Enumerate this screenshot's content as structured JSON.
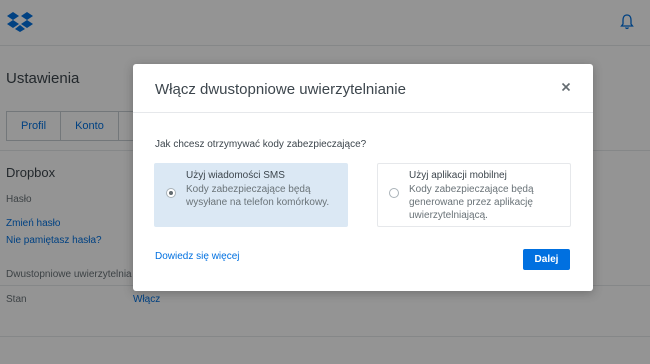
{
  "page": {
    "title": "Ustawienia",
    "tabs": [
      {
        "label": "Profil"
      },
      {
        "label": "Konto"
      },
      {
        "label": ""
      }
    ],
    "section_title": "Dropbox",
    "password_label": "Hasło",
    "change_password_link": "Zmień hasło",
    "forgot_password_link": "Nie pamiętasz hasła?",
    "two_step_label": "Dwustopniowe uwierzytelnia",
    "status_label": "Stan",
    "enable_link": "Włącz"
  },
  "modal": {
    "title": "Włącz dwustopniowe uwierzytelnianie",
    "question": "Jak chcesz otrzymywać kody zabezpieczające?",
    "options": [
      {
        "title": "Użyj wiadomości SMS",
        "description": "Kody zabezpieczające będą wysyłane na telefon komórkowy.",
        "selected": true
      },
      {
        "title": "Użyj aplikacji mobilnej",
        "description": "Kody zabezpieczające będą generowane przez aplikację uwierzytelniającą.",
        "selected": false
      }
    ],
    "learn_more_link": "Dowiedz się więcej",
    "next_button": "Dalej"
  },
  "colors": {
    "accent": "#0070e0",
    "selected_option_bg": "#dbe8f4",
    "overlay": "rgba(0,0,0,0.42)"
  },
  "icons": [
    "dropbox-logo-icon",
    "bell-icon",
    "close-icon",
    "radio-icon"
  ]
}
